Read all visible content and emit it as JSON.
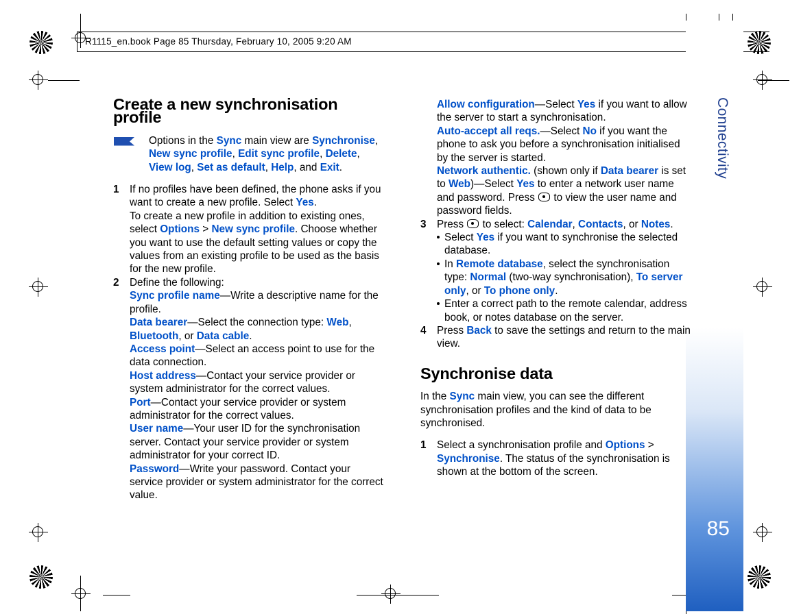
{
  "header": {
    "book_line": "R1115_en.book  Page 85  Thursday, February 10, 2005  9:20 AM"
  },
  "sidebar": {
    "tab_label": "Connectivity",
    "page_number": "85",
    "accent_color": "#1f5fc0",
    "label_color": "#1f3f8f"
  },
  "left_column": {
    "heading": "Create a new synchronisation profile",
    "note": {
      "t1": "Options in the ",
      "b1": "Sync",
      "t2": " main view are ",
      "b2": "Synchronise",
      "t3": ", ",
      "b3": "New sync profile",
      "t4": ", ",
      "b4": "Edit sync profile",
      "t5": ", ",
      "b5": "Delete",
      "t6": ", ",
      "b6": "View log",
      "t7": ", ",
      "b7": "Set as default",
      "t8": ", ",
      "b8": "Help",
      "t9": ", and ",
      "b9": "Exit",
      "t10": "."
    },
    "step1": {
      "num": "1",
      "t1": "If no profiles have been defined, the phone asks if you want to create a new profile. Select ",
      "b1": "Yes",
      "t2": ".",
      "t3": "To create a new profile in addition to existing ones, select ",
      "b2": "Options",
      "t4": " > ",
      "b3": "New sync profile",
      "t5": ". Choose whether you want to use the default setting values or copy the values from an existing profile to be used as the basis for the new profile."
    },
    "step2": {
      "num": "2",
      "intro": "Define the following:",
      "items": [
        {
          "label": "Sync profile name",
          "text": "—Write a descriptive name for the profile."
        },
        {
          "label": "Data bearer",
          "t1": "—Select the connection type: ",
          "b1": "Web",
          "t2": ", ",
          "b2": "Bluetooth",
          "t3": ", or ",
          "b3": "Data cable",
          "t4": "."
        },
        {
          "label": "Access point",
          "text": "—Select an access point to use for the data connection."
        },
        {
          "label": "Host address",
          "text": "—Contact your service provider or system administrator for the correct values."
        },
        {
          "label": "Port",
          "text": "—Contact your service provider or system administrator for the correct values."
        },
        {
          "label": "User name",
          "text": "—Your user ID for the synchronisation server. Contact your service provider or system administrator for your correct ID."
        },
        {
          "label": "Password",
          "text": "—Write your password. Contact your service provider or system administrator for the correct value."
        }
      ]
    }
  },
  "right_column": {
    "items": [
      {
        "label": "Allow configuration",
        "t1": "—Select ",
        "b1": "Yes",
        "t2": " if you want to allow the server to start a synchronisation."
      },
      {
        "label": "Auto-accept all reqs.",
        "t1": "—Select ",
        "b1": "No",
        "t2": " if you want the phone to ask you before a synchronisation initialised by the server is started."
      }
    ],
    "network_authentic": {
      "label": "Network authentic.",
      "t1": " (shown only if ",
      "b1": "Data bearer",
      "t2": " is set to ",
      "b2": "Web",
      "t3": ")—Select ",
      "b3": "Yes",
      "t4": " to enter a network user name and password. Press ",
      "t5": " to view the user name and password fields."
    },
    "step3": {
      "num": "3",
      "t1": "Press ",
      "t2": " to select: ",
      "b1": "Calendar",
      "t3": ", ",
      "b2": "Contacts",
      "t4": ", or ",
      "b3": "Notes",
      "t5": ".",
      "bullets": [
        {
          "t1": "Select ",
          "b1": "Yes",
          "t2": " if you want to synchronise the selected database."
        },
        {
          "t1": "In ",
          "b1": "Remote database",
          "t2": ", select the synchronisation type: ",
          "b2": "Normal",
          "t3": " (two-way synchronisation), ",
          "b3": "To server only",
          "t4": ", or ",
          "b4": "To phone only",
          "t5": "."
        },
        {
          "t1": "Enter a correct path to the remote calendar, address book, or notes database on the server.",
          "b1": "",
          "t2": ""
        }
      ]
    },
    "step4": {
      "num": "4",
      "t1": "Press ",
      "b1": "Back",
      "t2": " to save the settings and return to the main view."
    },
    "heading2": "Synchronise data",
    "intro": {
      "t1": "In the ",
      "b1": "Sync",
      "t2": " main view, you can see the different synchronisation profiles and the kind of data to be synchronised."
    },
    "step1": {
      "num": "1",
      "t1": "Select a synchronisation profile and ",
      "b1": "Options",
      "t2": " > ",
      "b2": "Synchronise",
      "t3": ". The status of the synchronisation is shown at the bottom of the screen."
    }
  }
}
